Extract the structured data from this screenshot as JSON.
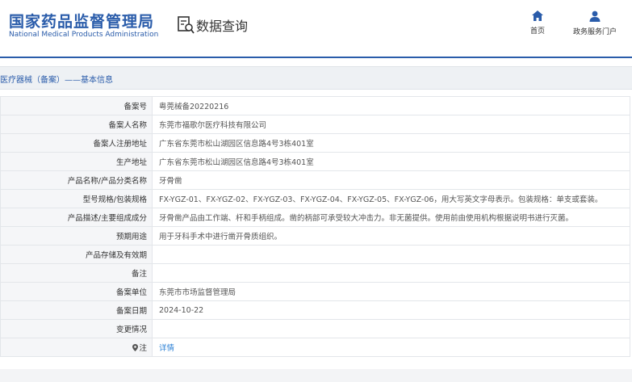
{
  "header": {
    "brand_cn": "国家药品监督管理局",
    "brand_en": "National Medical Products Administration",
    "page_title": "数据查询",
    "nav": [
      {
        "label": "首页",
        "icon": "home-icon"
      },
      {
        "label": "政务服务门户",
        "icon": "user-icon"
      }
    ]
  },
  "section": {
    "title": "医疗器械（备案）——基本信息"
  },
  "rows": [
    {
      "label": "备案号",
      "value": "粤莞械备20220216"
    },
    {
      "label": "备案人名称",
      "value": "东莞市福歌尔医疗科技有限公司"
    },
    {
      "label": "备案人注册地址",
      "value": "广东省东莞市松山湖园区信息路4号3栋401室"
    },
    {
      "label": "生产地址",
      "value": "广东省东莞市松山湖园区信息路4号3栋401室"
    },
    {
      "label": "产品名称/产品分类名称",
      "value": "牙骨凿"
    },
    {
      "label": "型号规格/包装规格",
      "value": "FX-YGZ-01、FX-YGZ-02、FX-YGZ-03、FX-YGZ-04、FX-YGZ-05、FX-YGZ-06，用大写英文字母表示。包装规格：单支或套装。"
    },
    {
      "label": "产品描述/主要组成成分",
      "value": "牙骨凿产品由工作端、杆和手柄组成。凿的柄部可承受较大冲击力。非无菌提供。使用前由使用机构根据说明书进行灭菌。"
    },
    {
      "label": "预期用途",
      "value": "用于牙科手术中进行凿开骨质组织。"
    },
    {
      "label": "产品存储及有效期",
      "value": ""
    },
    {
      "label": "备注",
      "value": ""
    },
    {
      "label": "备案单位",
      "value": "东莞市市场监督管理局"
    },
    {
      "label": "备案日期",
      "value": "2024-10-22"
    },
    {
      "label": "变更情况",
      "value": ""
    }
  ],
  "note_row": {
    "label": "注",
    "icon": "map-pin-icon",
    "link": "详情"
  },
  "colors": {
    "brand": "#2a5caa",
    "link": "#2a7fd4",
    "label_bg": "#f5f6f8",
    "border": "#e3e6ea"
  }
}
